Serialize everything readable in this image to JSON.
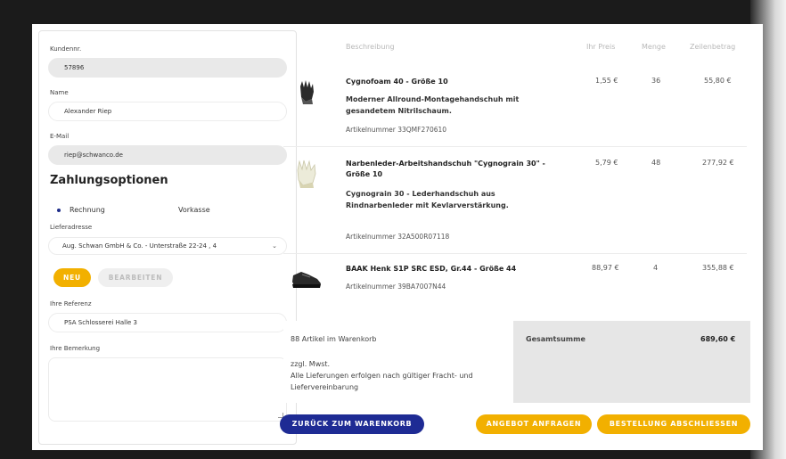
{
  "form": {
    "customer_no_label": "Kundennr.",
    "customer_no_value": "57896",
    "name_label": "Name",
    "name_value": "Alexander Riep",
    "email_label": "E-Mail",
    "email_value": "riep@schwanco.de",
    "payment_title": "Zahlungsoptionen",
    "payment_options": [
      "Rechnung",
      "Vorkasse"
    ],
    "payment_selected": "Rechnung",
    "delivery_label": "Lieferadresse",
    "delivery_value": "Aug. Schwan GmbH & Co. - Unterstraße 22-24 , 4",
    "btn_new": "NEU",
    "btn_edit": "BEARBEITEN",
    "reference_label": "Ihre Referenz",
    "reference_value": "PSA Schlosserei Halle 3",
    "remark_label": "Ihre Bemerkung",
    "remark_value": ""
  },
  "cart": {
    "headers": {
      "description": "Beschreibung",
      "price": "Ihr Preis",
      "qty": "Menge",
      "total": "Zeilenbetrag"
    },
    "items": [
      {
        "title": "Cygnofoam 40 - Größe 10",
        "desc": "Moderner Allround-Montagehandschuh mit gesandetem Nitrilschaum.",
        "article": "Artikelnummer 33QMF270610",
        "price": "1,55 €",
        "qty": "36",
        "total": "55,80 €",
        "icon": "black-glove-icon"
      },
      {
        "title": "Narbenleder-Arbeitshandschuh \"Cygnograin 30\" - Größe 10",
        "desc": "Cygnograin 30 - Lederhandschuh aus Rindnarbenleder mit Kevlarverstärkung.",
        "article": "Artikelnummer 32A500R07118",
        "price": "5,79 €",
        "qty": "48",
        "total": "277,92 €",
        "icon": "leather-glove-icon"
      },
      {
        "title": "BAAK Henk S1P SRC ESD, Gr.44 - Größe 44",
        "desc": "",
        "article": "Artikelnummer 39BA7007N44",
        "price": "88,97 €",
        "qty": "4",
        "total": "355,88 €",
        "icon": "safety-shoe-icon"
      }
    ],
    "count_text": "88 Artikel im Warenkorb",
    "sum_label": "Gesamtsumme",
    "sum_value": "689,60 €",
    "vat_note": "zzgl. Mwst.",
    "delivery_note": "Alle Lieferungen erfolgen nach gültiger Fracht- und Liefervereinbarung"
  },
  "buttons": {
    "back": "ZURÜCK ZUM WARENKORB",
    "quote": "ANGEBOT ANFRAGEN",
    "checkout": "BESTELLUNG ABSCHLIESSEN"
  },
  "colors": {
    "accent_yellow": "#f2b000",
    "primary_blue": "#1e2b94"
  }
}
